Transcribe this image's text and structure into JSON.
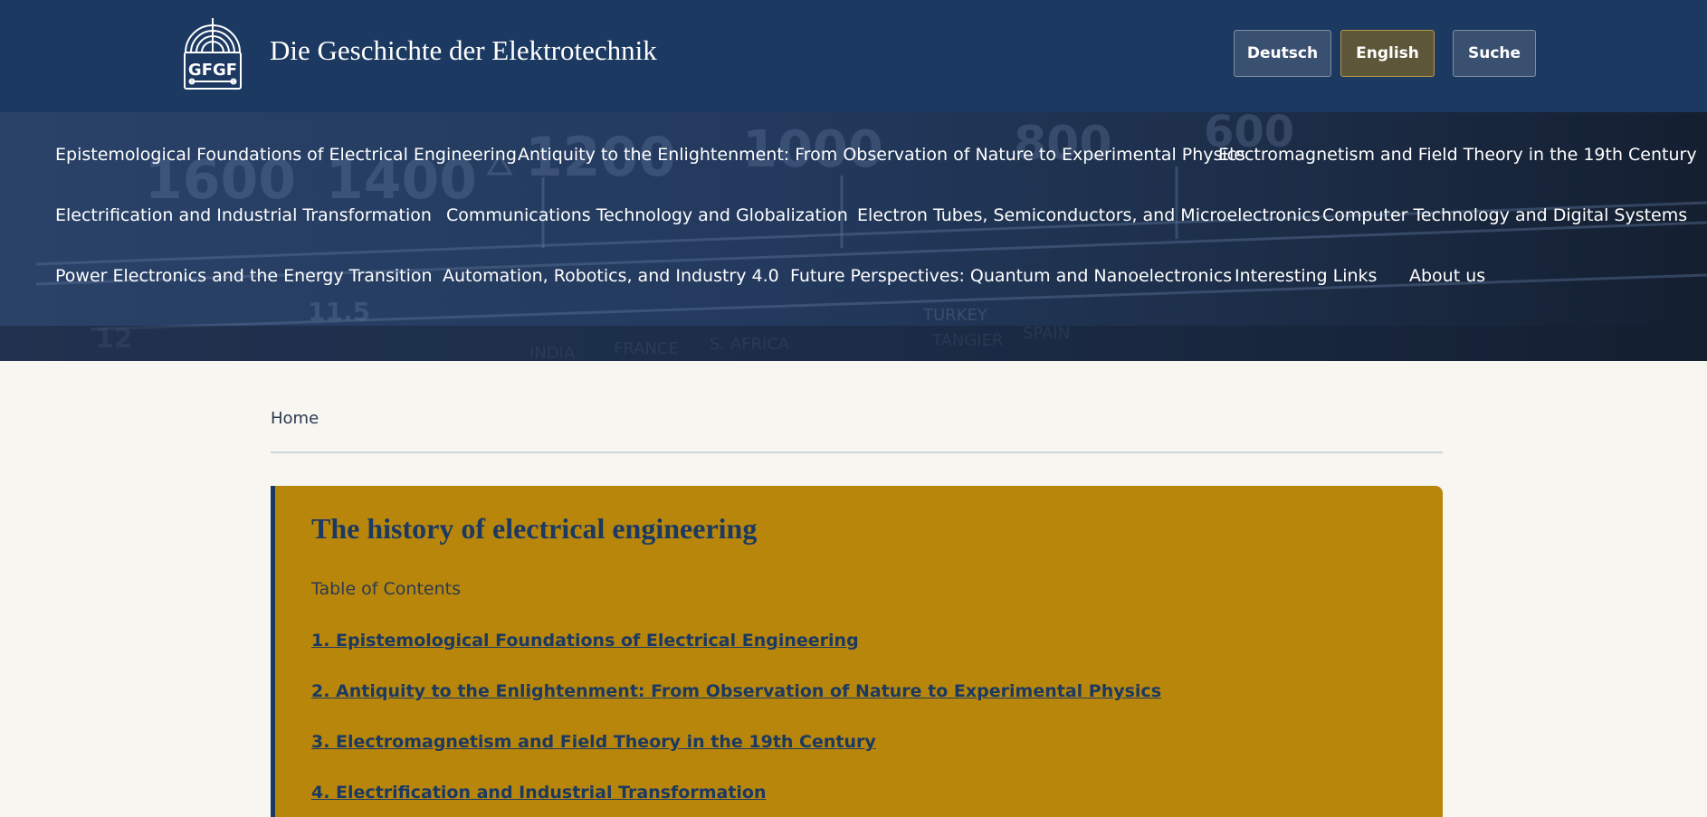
{
  "header": {
    "logo_text": "GFGF",
    "site_title": "Die Geschichte der Elektrotechnik",
    "languages": [
      {
        "label": "Deutsch",
        "active": false
      },
      {
        "label": "English",
        "active": true
      }
    ],
    "search_label": "Suche"
  },
  "nav": {
    "items": [
      {
        "label": "Epistemological Foundations of Electrical Engineering"
      },
      {
        "label": "Antiquity to the Enlightenment: From Observation of Nature to Experimental Physics"
      },
      {
        "label": "Electromagnetism and Field Theory in the 19th Century"
      },
      {
        "label": "Electrification and Industrial Transformation"
      },
      {
        "label": "Communications Technology and Globalization"
      },
      {
        "label": "Electron Tubes, Semiconductors, and Microelectronics"
      },
      {
        "label": "Computer Technology and Digital Systems"
      },
      {
        "label": "Power Electronics and the Energy Transition"
      },
      {
        "label": "Automation, Robotics, and Industry 4.0"
      },
      {
        "label": "Future Perspectives: Quantum and Nanoelectronics"
      },
      {
        "label": "Interesting Links"
      },
      {
        "label": "About us"
      }
    ]
  },
  "breadcrumb": {
    "home": "Home"
  },
  "main": {
    "title": "The history of electrical engineering",
    "toc_label": "Table of Contents",
    "toc": [
      {
        "label": "1. Epistemological Foundations of Electrical Engineering"
      },
      {
        "label": "2. Antiquity to the Enlightenment: From Observation of Nature to Experimental Physics"
      },
      {
        "label": "3. Electromagnetism and Field Theory in the 19th Century"
      },
      {
        "label": "4. Electrification and Industrial Transformation"
      }
    ]
  },
  "colors": {
    "header_bg": "#1c3961",
    "accent_gold": "#b8860b",
    "page_bg": "#f7f6f1"
  }
}
